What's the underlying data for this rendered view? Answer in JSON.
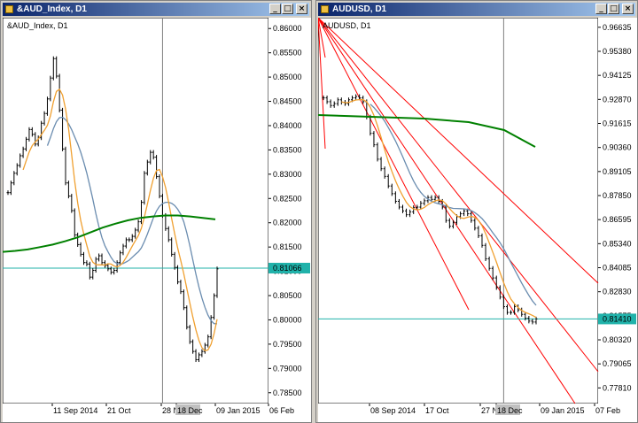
{
  "windows": [
    {
      "title": "&AUD_Index, D1",
      "label": "&AUD_Index, D1",
      "buttons": {
        "minimize": "_",
        "maximize": "□",
        "close": "×"
      },
      "price_labels": [
        "0.86000",
        "0.85500",
        "0.85000",
        "0.84500",
        "0.84000",
        "0.83500",
        "0.83000",
        "0.82500",
        "0.82000",
        "0.81500",
        "0.81000",
        "0.80500",
        "0.80000",
        "0.79500",
        "0.79000",
        "0.78500"
      ],
      "date_labels": [
        "11 Sep 2014",
        "21 Oct",
        "28 N",
        "18 Dec",
        "09 Jan 2015",
        "06 Feb"
      ],
      "current_price": "0.81066",
      "colors": {
        "background": "#ffffff",
        "candles": "#000000",
        "fast_ma": "#f0a030",
        "slow_ma": "#6a8caf",
        "long_ma": "#008000",
        "price_line": "#20b2aa",
        "price_tag": "#20b2aa",
        "vline": "#808080"
      }
    },
    {
      "title": "AUDUSD, D1",
      "label": "AUDUSD, D1",
      "buttons": {
        "minimize": "_",
        "maximize": "□",
        "close": "×"
      },
      "price_labels": [
        "0.96635",
        "0.95380",
        "0.94125",
        "0.92870",
        "0.91615",
        "0.90360",
        "0.89105",
        "0.87850",
        "0.86595",
        "0.85340",
        "0.84085",
        "0.82830",
        "0.81575",
        "0.80320",
        "0.79065",
        "0.77810"
      ],
      "date_labels": [
        "08 Sep 2014",
        "17 Oct",
        "27 N",
        "18 Dec",
        "09 Jan 2015",
        "07 Feb"
      ],
      "current_price": "0.81410",
      "colors": {
        "background": "#ffffff",
        "candles": "#000000",
        "fast_ma": "#f0a030",
        "slow_ma": "#6a8caf",
        "long_ma": "#008000",
        "price_line": "#20b2aa",
        "price_tag": "#20b2aa",
        "vline": "#808080",
        "channel": "#ff0000"
      }
    }
  ],
  "chart_data": [
    {
      "type": "line",
      "title": "&AUD_Index, D1",
      "ylim": [
        0.7835,
        0.8615
      ],
      "price_line": 0.81066,
      "close": [
        0.8262,
        0.8282,
        0.8302,
        0.8318,
        0.8338,
        0.8352,
        0.8372,
        0.8392,
        0.8382,
        0.8362,
        0.8375,
        0.8405,
        0.8425,
        0.8455,
        0.8498,
        0.8538,
        0.8502,
        0.8432,
        0.8352,
        0.8282,
        0.8255,
        0.8225,
        0.8175,
        0.8155,
        0.8135,
        0.8118,
        0.8115,
        0.8088,
        0.8102,
        0.8125,
        0.8132,
        0.8118,
        0.8112,
        0.8105,
        0.8098,
        0.8102,
        0.8118,
        0.8138,
        0.8152,
        0.8165,
        0.8165,
        0.8172,
        0.8185,
        0.8202,
        0.8242,
        0.8302,
        0.8325,
        0.8345,
        0.8335,
        0.8295,
        0.8255,
        0.8215,
        0.8188,
        0.8165,
        0.8135,
        0.8108,
        0.8078,
        0.8058,
        0.8025,
        0.7985,
        0.7955,
        0.7935,
        0.7918,
        0.7928,
        0.7935,
        0.7948,
        0.7965,
        0.8005,
        0.805,
        0.8105
      ],
      "long_ma": [
        0.814,
        0.8142,
        0.8145,
        0.815,
        0.8155,
        0.8162,
        0.817,
        0.818,
        0.819,
        0.8198,
        0.8205,
        0.821,
        0.8213,
        0.8215,
        0.8215,
        0.8213,
        0.821,
        0.8207
      ],
      "long_ma_start_index": 0,
      "vline_index": 51
    },
    {
      "type": "line",
      "title": "AUDUSD, D1",
      "ylim": [
        0.7718,
        0.9695
      ],
      "price_line": 0.8141,
      "close": [
        0.9295,
        0.9275,
        0.9255,
        0.9265,
        0.9285,
        0.9272,
        0.9265,
        0.9285,
        0.9295,
        0.9302,
        0.9295,
        0.9275,
        0.9195,
        0.911,
        0.905,
        0.8975,
        0.8925,
        0.8885,
        0.8835,
        0.8795,
        0.8755,
        0.8725,
        0.8705,
        0.8685,
        0.87,
        0.8722,
        0.8725,
        0.8745,
        0.8758,
        0.8775,
        0.8765,
        0.8775,
        0.8755,
        0.8725,
        0.8655,
        0.8625,
        0.8645,
        0.8675,
        0.869,
        0.8705,
        0.869,
        0.8655,
        0.8615,
        0.8575,
        0.8525,
        0.8455,
        0.8405,
        0.8355,
        0.8305,
        0.8255,
        0.8205,
        0.8175,
        0.8175,
        0.8205,
        0.8188,
        0.8165,
        0.8145,
        0.813,
        0.8125,
        0.8141
      ],
      "vline_index": 50
    }
  ]
}
